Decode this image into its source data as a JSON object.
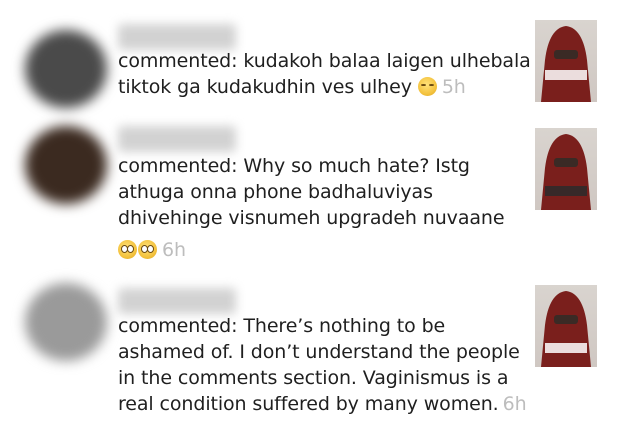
{
  "notifications": [
    {
      "action": "commented:",
      "lines": [
        "kudakoh balaa laigen ulhebala",
        "tiktok ga kudakudhin ves ulhey"
      ],
      "emoji": [
        "smirking-face"
      ],
      "time": "5h",
      "avatar_color": "#4a4a4a"
    },
    {
      "action": "commented:",
      "lines": [
        "Why so much hate? Istg",
        "athuga onna phone badhaluviyas",
        "dhivehinge visnumeh upgradeh nuvaane"
      ],
      "emoji": [
        "flushed-face",
        "flushed-face"
      ],
      "time": "6h",
      "avatar_color": "#3b2a20"
    },
    {
      "action": "commented:",
      "lines": [
        "There’s nothing to be",
        "ashamed of. I don’t understand the people",
        "in the comments section. Vaginismus is a",
        "real condition suffered by many women."
      ],
      "emoji": [],
      "time": "6h",
      "avatar_color": "#9a9a9a"
    }
  ],
  "colors": {
    "text": "#1f1f1f",
    "timestamp": "#bdbdbd",
    "veil": "#7a1f1c"
  }
}
